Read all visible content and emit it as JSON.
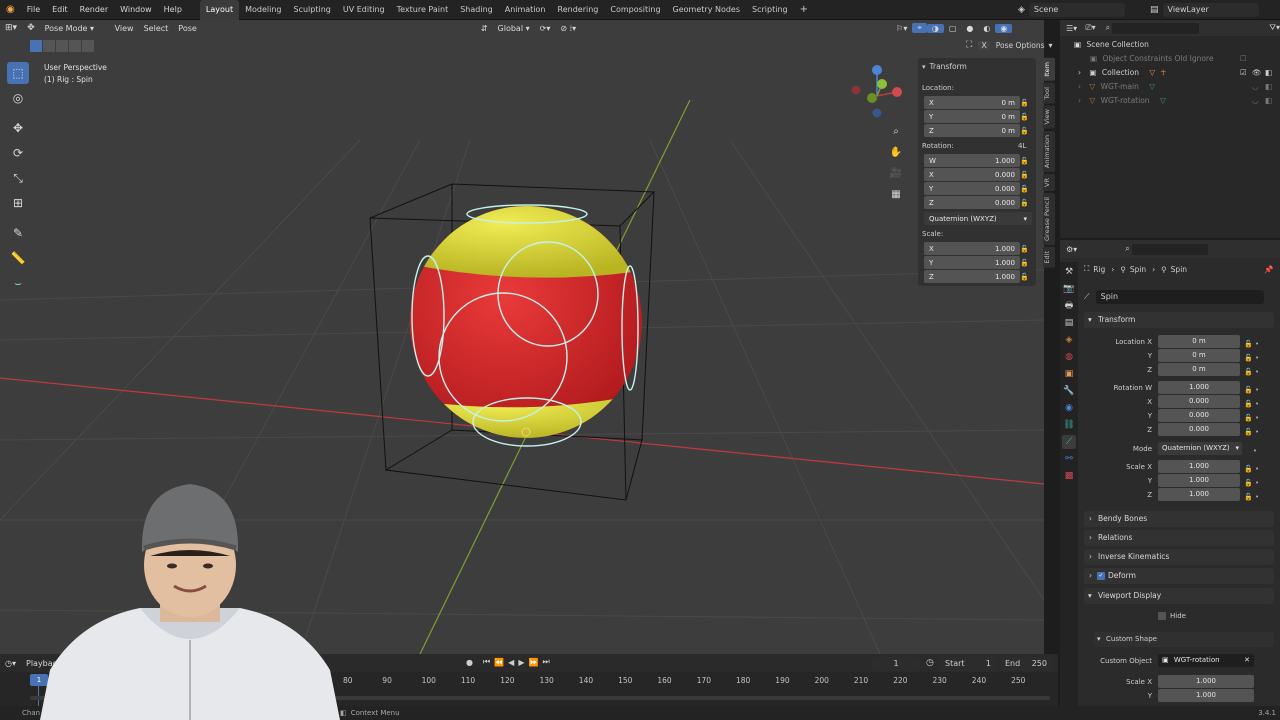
{
  "topbar": {
    "menus": [
      "File",
      "Edit",
      "Render",
      "Window",
      "Help"
    ],
    "workspaces": [
      "Layout",
      "Modeling",
      "Sculpting",
      "UV Editing",
      "Texture Paint",
      "Shading",
      "Animation",
      "Rendering",
      "Compositing",
      "Geometry Nodes",
      "Scripting"
    ],
    "active_workspace": "Layout",
    "scene": "Scene",
    "view_layer": "ViewLayer"
  },
  "viewport_header": {
    "mode": "Pose Mode",
    "menus": [
      "View",
      "Select",
      "Pose"
    ],
    "orientation": "Global",
    "pose_options": "Pose Options"
  },
  "viewport": {
    "perspective": "User Perspective",
    "context": "(1) Rig : Spin",
    "colors": {
      "background": "#3d3d3d",
      "x_axis": "#c0393f",
      "y_axis": "#7ea02f",
      "sphere_red": "#d3262c",
      "sphere_yellow": "#d6d43a",
      "bone_shape": "#c5f2ee"
    }
  },
  "npanel": {
    "title": "Transform",
    "location_label": "Location:",
    "location": [
      {
        "axis": "X",
        "value": "0 m"
      },
      {
        "axis": "Y",
        "value": "0 m"
      },
      {
        "axis": "Z",
        "value": "0 m"
      }
    ],
    "rotation_label": "Rotation:",
    "rotation_tag": "4L",
    "rotation": [
      {
        "axis": "W",
        "value": "1.000"
      },
      {
        "axis": "X",
        "value": "0.000"
      },
      {
        "axis": "Y",
        "value": "0.000"
      },
      {
        "axis": "Z",
        "value": "0.000"
      }
    ],
    "rotation_mode": "Quaternion (WXYZ)",
    "scale_label": "Scale:",
    "scale": [
      {
        "axis": "X",
        "value": "1.000"
      },
      {
        "axis": "Y",
        "value": "1.000"
      },
      {
        "axis": "Z",
        "value": "1.000"
      }
    ],
    "tabs": [
      "Item",
      "Tool",
      "View",
      "Animation",
      "VR",
      "Grease Pencil",
      "Edit"
    ]
  },
  "outliner": {
    "root": "Scene Collection",
    "items": [
      "Object Constraints Old Ignore",
      "Collection",
      "WGT-main",
      "WGT-rotation"
    ]
  },
  "properties": {
    "breadcrumb": [
      "Rig",
      "Spin",
      "Spin"
    ],
    "bone_name": "Spin",
    "transform_title": "Transform",
    "location_x_label": "Location X",
    "location": [
      "0 m",
      "0 m",
      "0 m"
    ],
    "rotation_w_label": "Rotation W",
    "rotation": [
      "1.000",
      "0.000",
      "0.000",
      "0.000"
    ],
    "mode_label": "Mode",
    "mode": "Quaternion (WXYZ)",
    "scale_x_label": "Scale X",
    "scale": [
      "1.000",
      "1.000",
      "1.000"
    ],
    "axis_y": "Y",
    "axis_z": "Z",
    "axis_x": "X",
    "sections": [
      "Bendy Bones",
      "Relations",
      "Inverse Kinematics",
      "Deform",
      "Viewport Display"
    ],
    "hide_label": "Hide",
    "custom_shape_title": "Custom Shape",
    "custom_object_label": "Custom Object",
    "custom_object": "WGT-rotation",
    "cs_scale_x_label": "Scale X",
    "cs_scale": [
      "1.000",
      "1.000"
    ]
  },
  "timeline": {
    "playback": "Playback",
    "current_frame": "1",
    "start_label": "Start",
    "start": "1",
    "end_label": "End",
    "end": "250",
    "frame_marker": "1",
    "ticks": [
      "80",
      "90",
      "100",
      "110",
      "120",
      "130",
      "140",
      "150",
      "160",
      "170",
      "180",
      "190",
      "200",
      "210",
      "220",
      "230",
      "240",
      "250"
    ]
  },
  "status": {
    "left": "Chan",
    "context_menu": "Context Menu",
    "version": "3.4.1"
  }
}
